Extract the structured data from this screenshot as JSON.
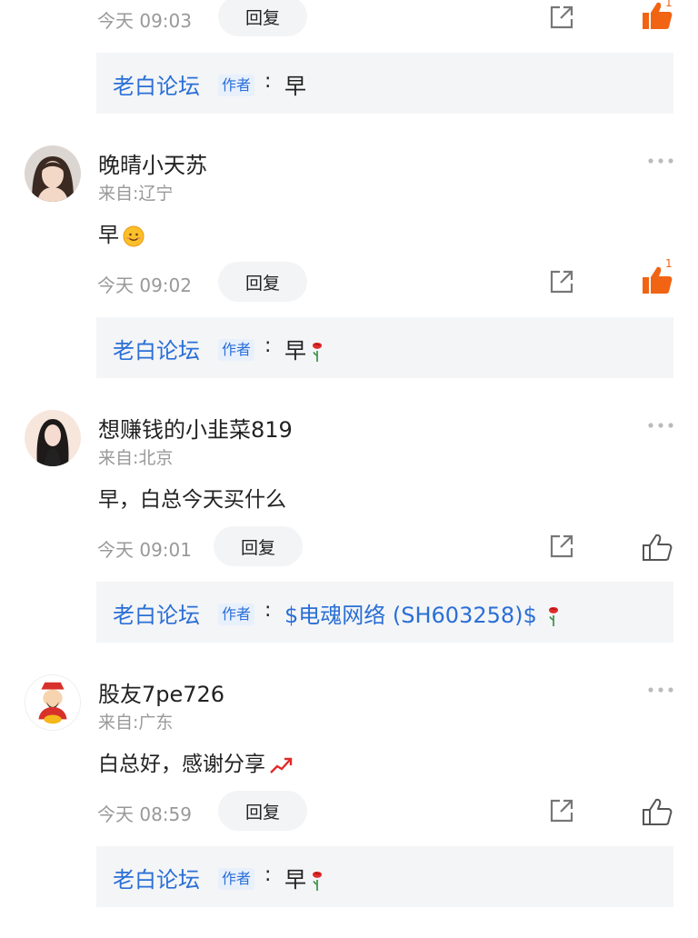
{
  "colors": {
    "accent": "#2a6fd6",
    "like_active": "#f06414",
    "muted": "#999999",
    "reply_bg": "#f4f5f7"
  },
  "comments": [
    {
      "time": "今天 09:03",
      "reply_label": "回复",
      "like_count": "1",
      "like_state": "active",
      "reply": {
        "name": "老白论坛",
        "tag": "作者",
        "colon": ":",
        "text": "早"
      }
    },
    {
      "user": "晚晴小天苏",
      "location": "来自:辽宁",
      "text": "早",
      "emoji": "smile-emoji",
      "time": "今天 09:02",
      "reply_label": "回复",
      "like_count": "1",
      "like_state": "active",
      "reply": {
        "name": "老白论坛",
        "tag": "作者",
        "colon": ":",
        "text": "早",
        "emoji": "rose-emoji"
      }
    },
    {
      "user": "想赚钱的小韭菜819",
      "location": "来自:北京",
      "text": "早，白总今天买什么",
      "time": "今天 09:01",
      "reply_label": "回复",
      "like_state": "inactive",
      "reply": {
        "name": "老白论坛",
        "tag": "作者",
        "colon": ":",
        "text": "$电魂网络 (SH603258)$",
        "emoji": "rose-emoji"
      }
    },
    {
      "user": "股友7pe726",
      "location": "来自:广东",
      "text": "白总好，感谢分享",
      "emoji": "rising-chart-emoji",
      "time": "今天 08:59",
      "reply_label": "回复",
      "like_state": "inactive",
      "reply": {
        "name": "老白论坛",
        "tag": "作者",
        "colon": ":",
        "text": "早",
        "emoji": "rose-emoji"
      }
    }
  ]
}
